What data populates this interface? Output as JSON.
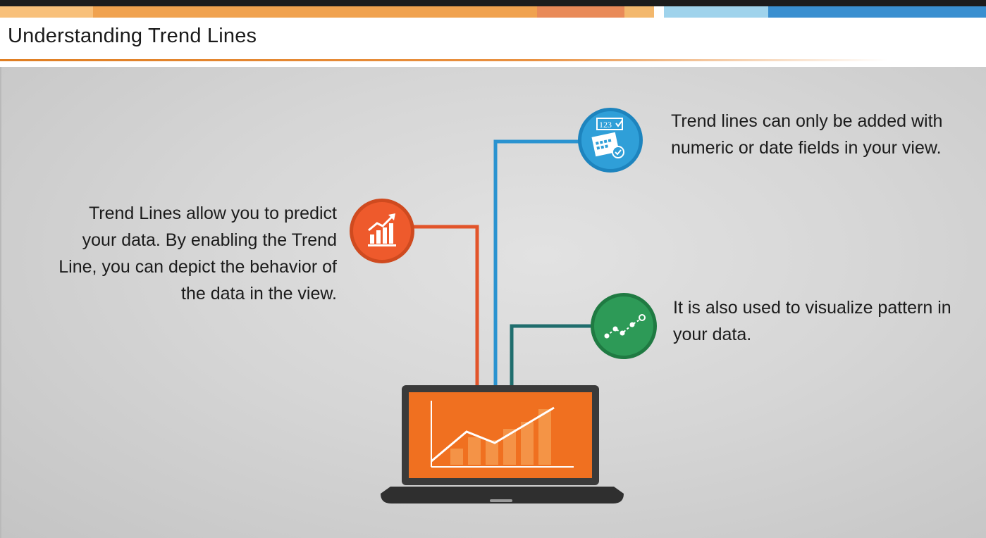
{
  "header": {
    "title": "Understanding Trend Lines"
  },
  "colors": {
    "strip": [
      "#f8c07a",
      "#f0a24f",
      "#e98a58",
      "#f3b86d",
      "#9fd3ec",
      "#3a8fd0"
    ],
    "accent_orange": "#ee5a2c",
    "accent_blue": "#2f9fd8",
    "accent_green": "#2d9a57",
    "laptop_screen": "#f07020"
  },
  "callouts": {
    "left": "Trend Lines allow you to predict your data. By enabling the Trend Line, you can depict the behavior of the data in the view.",
    "top_right": "Trend lines can only be added with numeric or date fields in your view.",
    "right": "It is also used to visualize pattern in your data."
  },
  "icons": {
    "growth": "growth-chart-icon",
    "numeric": "numeric-date-calendar-icon",
    "pattern": "scatter-pattern-icon",
    "numeric_label": "123"
  }
}
